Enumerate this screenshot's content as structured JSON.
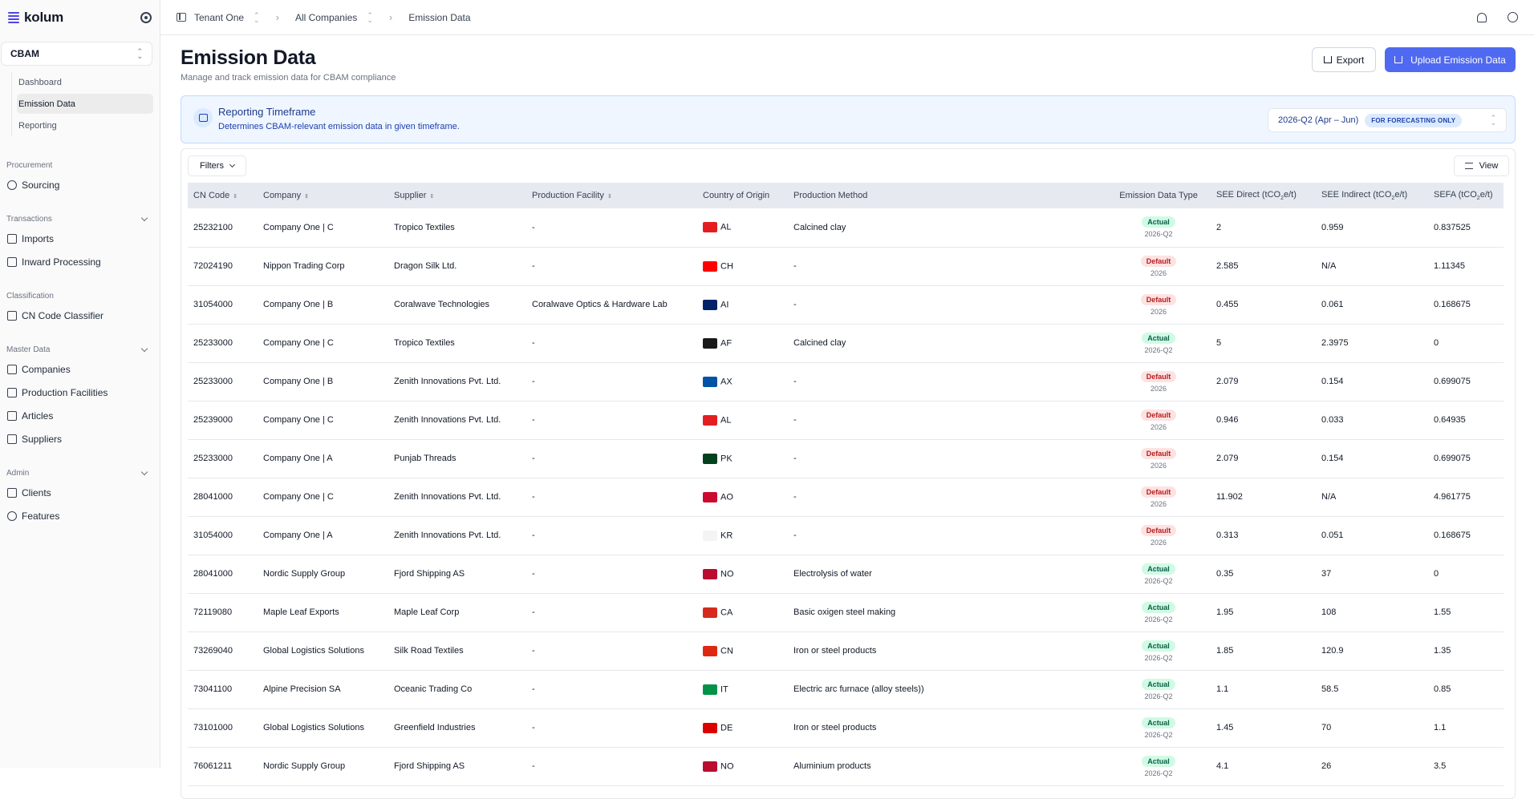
{
  "sidebar": {
    "brand": "kolum",
    "module": "CBAM",
    "module_items": [
      "Dashboard",
      "Emission Data",
      "Reporting"
    ],
    "sections": [
      {
        "label": "Procurement",
        "items": [
          {
            "label": "Sourcing",
            "icon": "search-icon"
          }
        ]
      },
      {
        "label": "Transactions",
        "items": [
          {
            "label": "Imports",
            "icon": "import-icon"
          },
          {
            "label": "Inward Processing",
            "icon": "package-icon"
          }
        ]
      },
      {
        "label": "Classification",
        "items": [
          {
            "label": "CN Code Classifier",
            "icon": "scan-icon"
          }
        ]
      },
      {
        "label": "Master Data",
        "items": [
          {
            "label": "Companies",
            "icon": "building-icon"
          },
          {
            "label": "Production Facilities",
            "icon": "factory-icon"
          },
          {
            "label": "Articles",
            "icon": "book-icon"
          },
          {
            "label": "Suppliers",
            "icon": "truck-icon"
          }
        ]
      },
      {
        "label": "Admin",
        "items": [
          {
            "label": "Clients",
            "icon": "network-icon"
          },
          {
            "label": "Features",
            "icon": "eye-icon"
          }
        ]
      }
    ]
  },
  "topbar": {
    "tenant": "Tenant One",
    "companies": "All Companies",
    "current": "Emission Data"
  },
  "header": {
    "title": "Emission Data",
    "subtitle": "Manage and track emission data for CBAM compliance",
    "export_label": "Export",
    "upload_label": "Upload Emission Data"
  },
  "timeframe": {
    "title": "Reporting Timeframe",
    "description": "Determines CBAM-relevant emission data in given timeframe.",
    "selected": "2026-Q2 (Apr – Jun)",
    "badge": "FOR FORECASTING ONLY"
  },
  "table": {
    "filters_label": "Filters",
    "view_label": "View",
    "columns": [
      "CN Code",
      "Company",
      "Supplier",
      "Production Facility",
      "Country of Origin",
      "Production Method",
      "Emission Data Type",
      "SEE Direct (tCO",
      "SEE Indirect (tCO",
      "SEFA (tCO"
    ],
    "unit_sub": "2",
    "unit_tail": "e/t)",
    "rows": [
      {
        "cn": "25232100",
        "company": "Company One | C",
        "supplier": "Tropico Textiles",
        "facility": "-",
        "country": "AL",
        "flag": "#e41e20",
        "method": "Calcined clay",
        "type": "Actual",
        "period": "2026-Q2",
        "direct": "2",
        "indirect": "0.959",
        "sefa": "0.837525"
      },
      {
        "cn": "72024190",
        "company": "Nippon Trading Corp",
        "supplier": "Dragon Silk Ltd.",
        "facility": "-",
        "country": "CH",
        "flag": "#ff0000",
        "method": "-",
        "type": "Default",
        "period": "2026",
        "direct": "2.585",
        "indirect": "N/A",
        "sefa": "1.11345"
      },
      {
        "cn": "31054000",
        "company": "Company One | B",
        "supplier": "Coralwave Technologies",
        "facility": "Coralwave Optics & Hardware Lab",
        "country": "AI",
        "flag": "#012169",
        "method": "-",
        "type": "Default",
        "period": "2026",
        "direct": "0.455",
        "indirect": "0.061",
        "sefa": "0.168675"
      },
      {
        "cn": "25233000",
        "company": "Company One | C",
        "supplier": "Tropico Textiles",
        "facility": "-",
        "country": "AF",
        "flag": "#1a1a1a",
        "method": "Calcined clay",
        "type": "Actual",
        "period": "2026-Q2",
        "direct": "5",
        "indirect": "2.3975",
        "sefa": "0"
      },
      {
        "cn": "25233000",
        "company": "Company One | B",
        "supplier": "Zenith Innovations Pvt. Ltd.",
        "facility": "-",
        "country": "AX",
        "flag": "#0053a5",
        "method": "-",
        "type": "Default",
        "period": "2026",
        "direct": "2.079",
        "indirect": "0.154",
        "sefa": "0.699075"
      },
      {
        "cn": "25239000",
        "company": "Company One | C",
        "supplier": "Zenith Innovations Pvt. Ltd.",
        "facility": "-",
        "country": "AL",
        "flag": "#e41e20",
        "method": "-",
        "type": "Default",
        "period": "2026",
        "direct": "0.946",
        "indirect": "0.033",
        "sefa": "0.64935"
      },
      {
        "cn": "25233000",
        "company": "Company One | A",
        "supplier": "Punjab Threads",
        "facility": "-",
        "country": "PK",
        "flag": "#01411c",
        "method": "-",
        "type": "Default",
        "period": "2026",
        "direct": "2.079",
        "indirect": "0.154",
        "sefa": "0.699075"
      },
      {
        "cn": "28041000",
        "company": "Company One | C",
        "supplier": "Zenith Innovations Pvt. Ltd.",
        "facility": "-",
        "country": "AO",
        "flag": "#cc092f",
        "method": "-",
        "type": "Default",
        "period": "2026",
        "direct": "11.902",
        "indirect": "N/A",
        "sefa": "4.961775"
      },
      {
        "cn": "31054000",
        "company": "Company One | A",
        "supplier": "Zenith Innovations Pvt. Ltd.",
        "facility": "-",
        "country": "KR",
        "flag": "#f4f4f4",
        "method": "-",
        "type": "Default",
        "period": "2026",
        "direct": "0.313",
        "indirect": "0.051",
        "sefa": "0.168675"
      },
      {
        "cn": "28041000",
        "company": "Nordic Supply Group",
        "supplier": "Fjord Shipping AS",
        "facility": "-",
        "country": "NO",
        "flag": "#ba0c2f",
        "method": "Electrolysis of water",
        "type": "Actual",
        "period": "2026-Q2",
        "direct": "0.35",
        "indirect": "37",
        "sefa": "0"
      },
      {
        "cn": "72119080",
        "company": "Maple Leaf Exports",
        "supplier": "Maple Leaf Corp",
        "facility": "-",
        "country": "CA",
        "flag": "#d52b1e",
        "method": "Basic oxigen steel making",
        "type": "Actual",
        "period": "2026-Q2",
        "direct": "1.95",
        "indirect": "108",
        "sefa": "1.55"
      },
      {
        "cn": "73269040",
        "company": "Global Logistics Solutions",
        "supplier": "Silk Road Textiles",
        "facility": "-",
        "country": "CN",
        "flag": "#de2910",
        "method": "Iron or steel products",
        "type": "Actual",
        "period": "2026-Q2",
        "direct": "1.85",
        "indirect": "120.9",
        "sefa": "1.35"
      },
      {
        "cn": "73041100",
        "company": "Alpine Precision SA",
        "supplier": "Oceanic Trading Co",
        "facility": "-",
        "country": "IT",
        "flag": "#009246",
        "method": "Electric arc furnace (alloy steels))",
        "type": "Actual",
        "period": "2026-Q2",
        "direct": "1.1",
        "indirect": "58.5",
        "sefa": "0.85"
      },
      {
        "cn": "73101000",
        "company": "Global Logistics Solutions",
        "supplier": "Greenfield Industries",
        "facility": "-",
        "country": "DE",
        "flag": "#dd0000",
        "method": "Iron or steel products",
        "type": "Actual",
        "period": "2026-Q2",
        "direct": "1.45",
        "indirect": "70",
        "sefa": "1.1"
      },
      {
        "cn": "76061211",
        "company": "Nordic Supply Group",
        "supplier": "Fjord Shipping AS",
        "facility": "-",
        "country": "NO",
        "flag": "#ba0c2f",
        "method": "Aluminium products",
        "type": "Actual",
        "period": "2026-Q2",
        "direct": "4.1",
        "indirect": "26",
        "sefa": "3.5"
      }
    ]
  }
}
